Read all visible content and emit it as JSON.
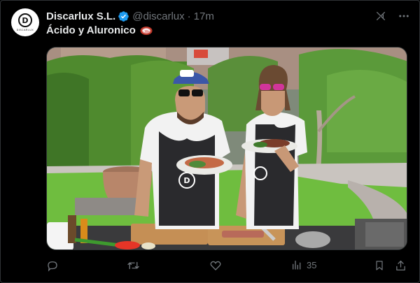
{
  "tweet": {
    "author": {
      "display_name": "Discarlux S.L.",
      "handle": "@discarlux",
      "separator": "·",
      "time": "17m",
      "verified": true,
      "avatar_letter": "D",
      "avatar_text": "DISCARLUX"
    },
    "text": "Ácido y Aluronico",
    "emoji": "steak-emoji",
    "media": {
      "description_icon": "photo",
      "apron_logo": "D"
    },
    "actions": {
      "reply_count": "",
      "retweet_count": "",
      "like_count": "",
      "views_count": "35"
    }
  },
  "colors": {
    "background": "#000000",
    "text_primary": "#e7e9ea",
    "text_secondary": "#71767b",
    "verified_blue": "#1d9bf0",
    "border": "#2f3336"
  }
}
